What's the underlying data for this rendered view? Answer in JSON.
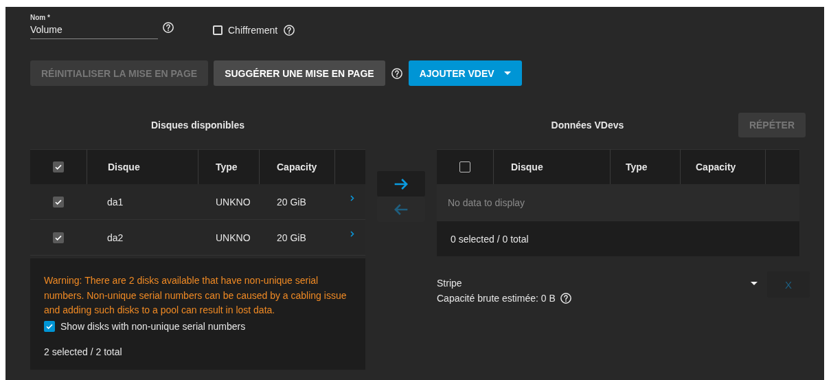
{
  "name_field": {
    "label": "Nom *",
    "value": "Volume"
  },
  "encryption": {
    "label": "Chiffrement",
    "checked": false
  },
  "buttons": [
    {
      "label": "RÉINITIALISER LA MISE EN PAGE",
      "kind": "flat",
      "disabled": true
    },
    {
      "label": "SUGGÉRER UNE MISE EN PAGE",
      "kind": "flat",
      "disabled": false
    },
    {
      "label": "AJOUTER VDEV",
      "kind": "split"
    }
  ],
  "available": {
    "title": "Disques disponibles",
    "columns": [
      "Disque",
      "Type",
      "Capacity"
    ],
    "all_checked": true,
    "rows": [
      {
        "disk": "da1",
        "type": "UNKNO",
        "capacity": "20 GiB",
        "checked": true
      },
      {
        "disk": "da2",
        "type": "UNKNO",
        "capacity": "20 GiB",
        "checked": true
      }
    ],
    "warning": "Warning: There are 2 disks available that have non-unique serial numbers. Non-unique serial numbers can be caused by a cabling issue and adding such disks to a pool can result in lost data.",
    "show_non_unique": {
      "label": "Show disks with non-unique serial numbers",
      "checked": true
    },
    "footer": "2 selected / 2 total"
  },
  "move_buttons": [
    {
      "kind": "right",
      "disabled": false
    },
    {
      "kind": "left",
      "disabled": true
    }
  ],
  "data_vdevs": {
    "title": "Données VDevs",
    "repeat": {
      "label": "RÉPÉTER",
      "disabled": true
    },
    "columns": [
      "Disque",
      "Type",
      "Capacity"
    ],
    "all_checked": false,
    "empty": "No data to display",
    "footer": "0 selected / 0 total",
    "layout": "Stripe",
    "capacity": "Capacité brute estimée: 0 B",
    "remove": {
      "label": "X",
      "disabled": true
    }
  }
}
